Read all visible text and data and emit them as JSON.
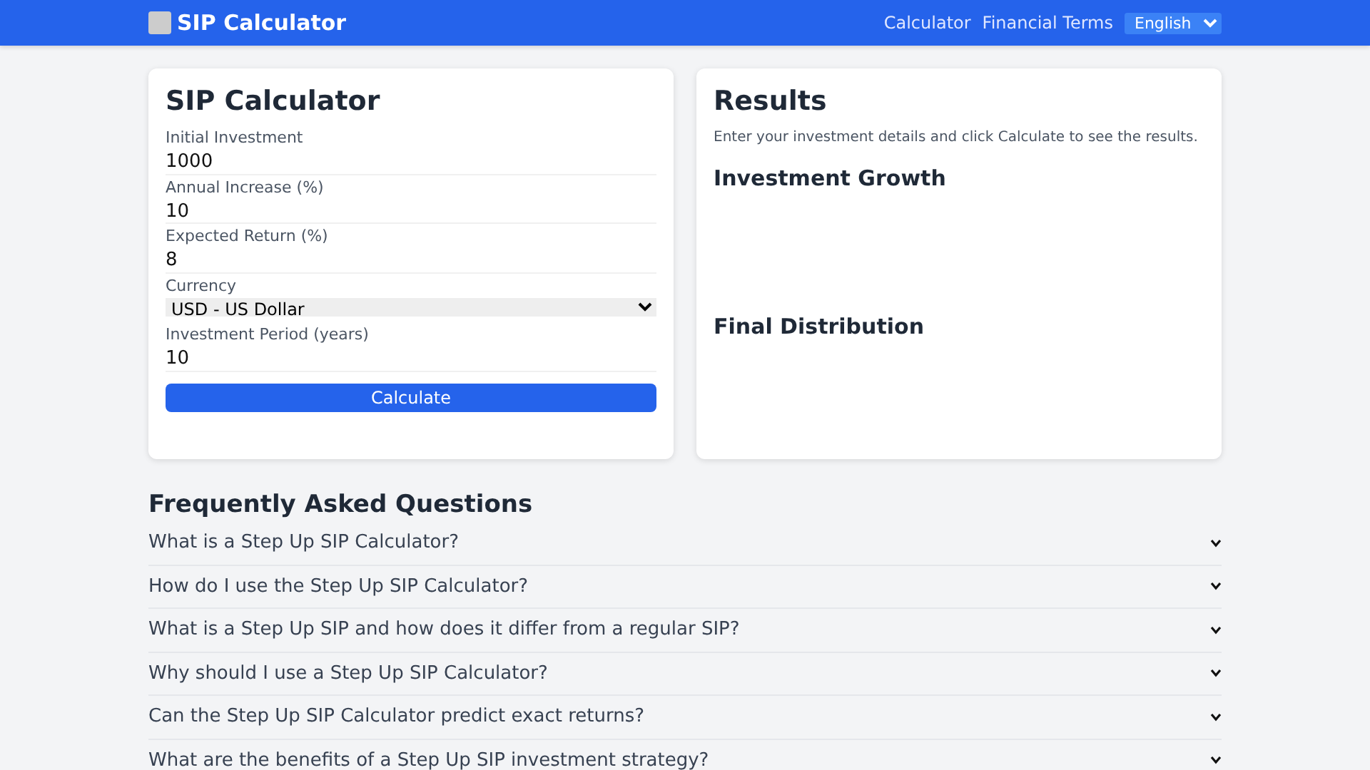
{
  "navbar": {
    "brand": "SIP Calculator",
    "links": [
      "Calculator",
      "Financial Terms"
    ],
    "language": "English"
  },
  "calculator": {
    "title": "SIP Calculator",
    "fields": [
      {
        "kind": "input",
        "label": "Initial Investment",
        "value": "1000"
      },
      {
        "kind": "input",
        "label": "Annual Increase (%)",
        "value": "10"
      },
      {
        "kind": "input",
        "label": "Expected Return (%)",
        "value": "8"
      },
      {
        "kind": "select",
        "label": "Currency",
        "value": "USD - US Dollar"
      },
      {
        "kind": "input",
        "label": "Investment Period (years)",
        "value": "10"
      }
    ],
    "button": "Calculate"
  },
  "results": {
    "title": "Results",
    "message": "Enter your investment details and click Calculate to see the results.",
    "sections": [
      "Investment Growth",
      "Final Distribution"
    ]
  },
  "faq": {
    "title": "Frequently Asked Questions",
    "items": [
      {
        "question": "What is a Step Up SIP Calculator?",
        "expanded": false
      },
      {
        "question": "How do I use the Step Up SIP Calculator?",
        "expanded": false
      },
      {
        "question": "What is a Step Up SIP and how does it differ from a regular SIP?",
        "expanded": false
      },
      {
        "question": "Why should I use a Step Up SIP Calculator?",
        "expanded": false
      },
      {
        "question": "Can the Step Up SIP Calculator predict exact returns?",
        "expanded": false
      },
      {
        "question": "What are the benefits of a Step Up SIP investment strategy?",
        "expanded": false
      }
    ]
  }
}
